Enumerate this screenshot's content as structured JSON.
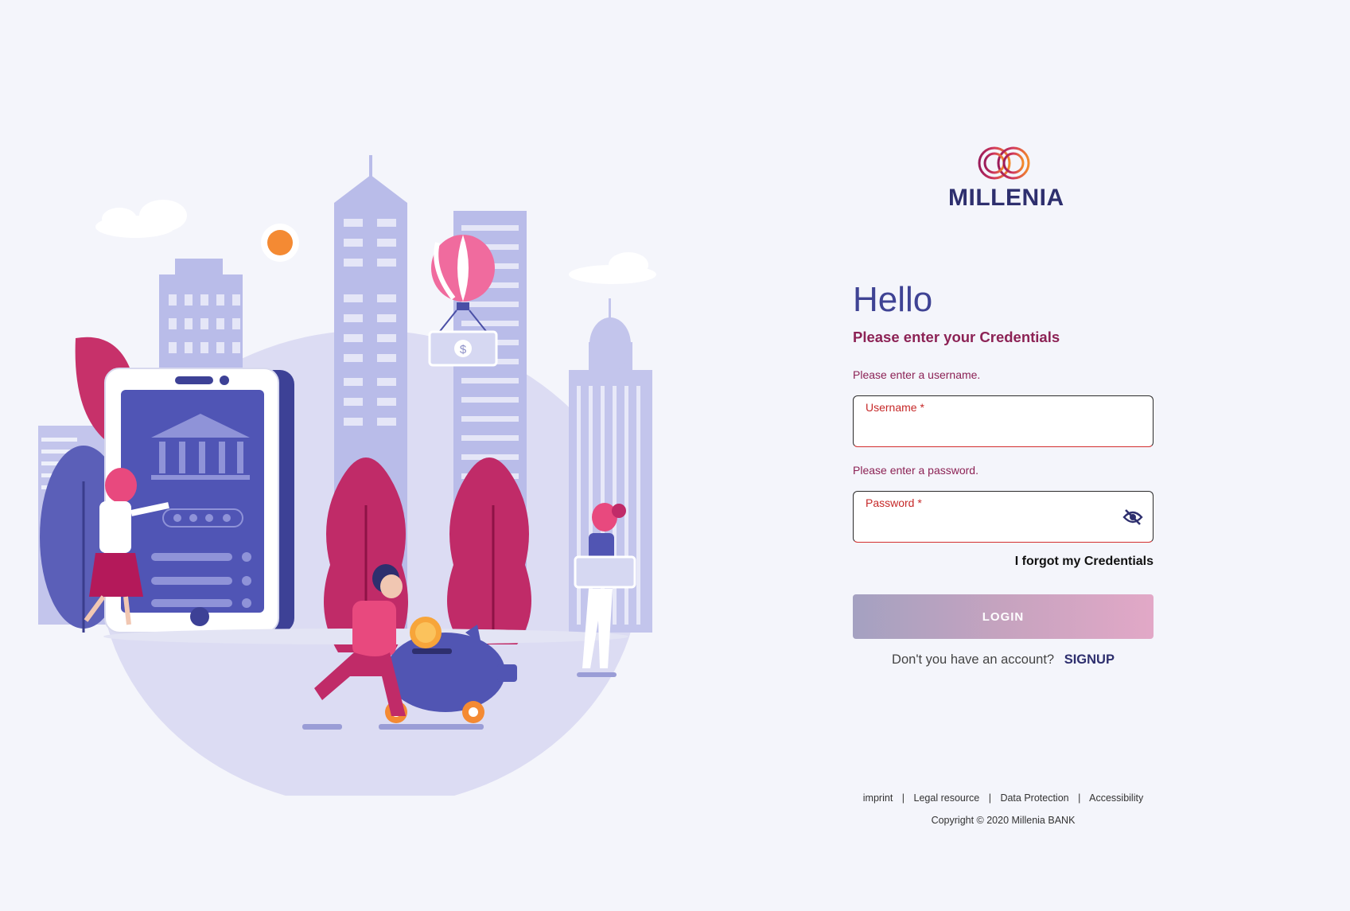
{
  "brand": {
    "name": "MILLENIA",
    "accent": "#3f4394",
    "secondary": "#8c2255"
  },
  "login": {
    "greeting": "Hello",
    "subtitle": "Please enter your Credentials",
    "username_error": "Please enter a username.",
    "username_label": "Username *",
    "username_value": "",
    "password_error": "Please enter a password.",
    "password_label": "Password *",
    "password_value": "",
    "password_toggle_icon": "eye-off-icon",
    "forgot_label": "I forgot my Credentials",
    "login_label": "LOGIN",
    "signup_prompt": "Don't you have an account?",
    "signup_label": "SIGNUP"
  },
  "footer": {
    "links": [
      "imprint",
      "Legal resource",
      "Data Protection",
      "Accessibility"
    ],
    "copyright": "Copyright © 2020 Millenia BANK"
  }
}
